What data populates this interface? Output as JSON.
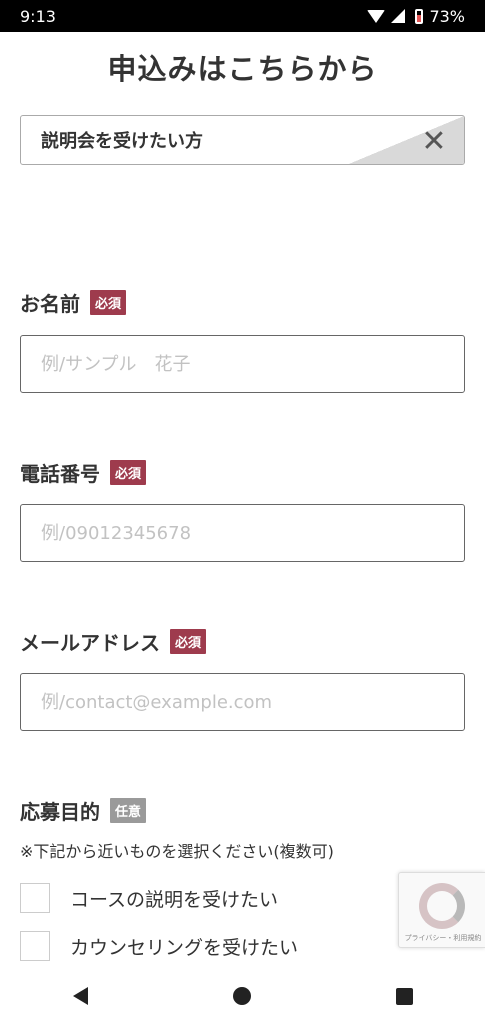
{
  "status_bar": {
    "time": "9:13",
    "battery": "73%"
  },
  "page_title": "申込みはこちらから",
  "selected_option": {
    "label": "説明会を受けたい方",
    "close_symbol": "✕"
  },
  "fields": {
    "name": {
      "label": "お名前",
      "badge": "必須",
      "placeholder": "例/サンプル　花子",
      "value": ""
    },
    "phone": {
      "label": "電話番号",
      "badge": "必須",
      "placeholder": "例/09012345678",
      "value": ""
    },
    "email": {
      "label": "メールアドレス",
      "badge": "必須",
      "placeholder": "例/contact@example.com",
      "value": ""
    }
  },
  "purpose": {
    "label": "応募目的",
    "badge": "任意",
    "note": "※下記から近いものを選択ください(複数可)",
    "options": [
      "コースの説明を受けたい",
      "カウンセリングを受けたい"
    ]
  },
  "recaptcha": {
    "text": "プライバシー・利用規約"
  },
  "colors": {
    "required_badge": "#9e3b4d",
    "optional_badge": "#9a9a9a",
    "text": "#333333"
  },
  "icons": {
    "back": "back-triangle-icon",
    "home": "home-circle-icon",
    "recent": "recent-square-icon"
  }
}
